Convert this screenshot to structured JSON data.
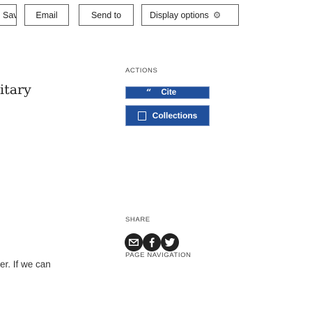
{
  "toolbar": {
    "save_label": "Save",
    "email_label": "Email",
    "send_to_label": "Send to",
    "display_options_label": "Display options",
    "display_options_icon": "gear-icon"
  },
  "main": {
    "title_fragment": "itary",
    "text_fragment": "er. If we can"
  },
  "actions": {
    "heading": "ACTIONS",
    "cite_label": "Cite",
    "cite_icon": "quote-icon",
    "collections_label": "Collections",
    "collections_icon": "folder-icon"
  },
  "share": {
    "heading": "SHARE",
    "buttons": [
      "email-share-icon",
      "facebook-icon",
      "twitter-icon"
    ]
  },
  "page_navigation": {
    "heading": "PAGE NAVIGATION"
  },
  "colors": {
    "action_blue": "#20509c",
    "share_dark": "#222222"
  }
}
